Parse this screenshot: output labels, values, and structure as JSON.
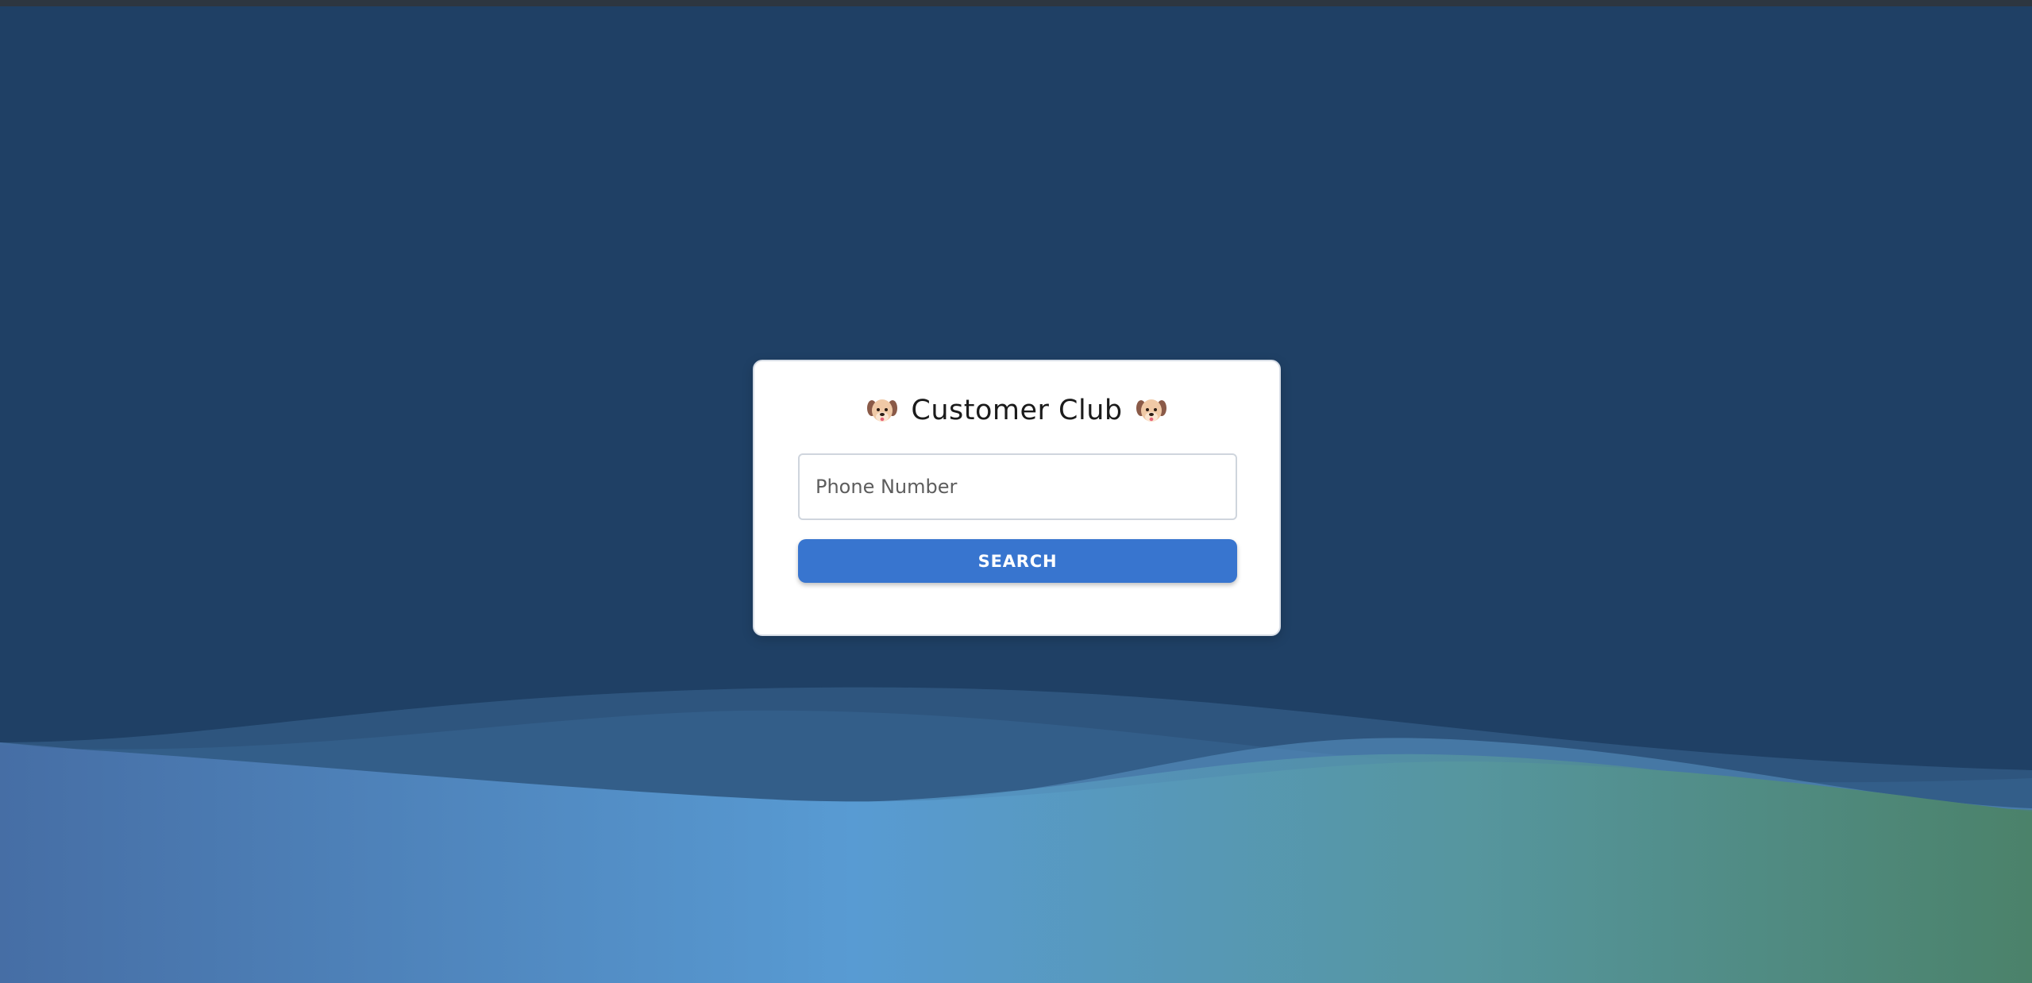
{
  "page": {
    "title": "Customer Club",
    "background_color": "#1f4065"
  },
  "title_icon": "dog-face-icon",
  "search": {
    "input_value": "",
    "placeholder": "Phone Number",
    "button_label": "SEARCH",
    "button_color": "#3875cf"
  },
  "waves": {
    "gradient_colors": [
      "#4670a6",
      "#589bd2",
      "#4e8a70"
    ]
  }
}
